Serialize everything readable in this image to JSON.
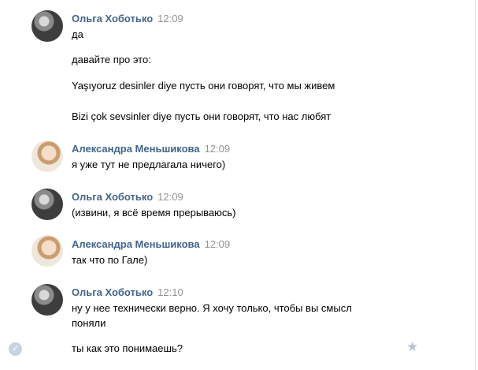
{
  "messages": [
    {
      "author": "Ольга Хоботько",
      "time": "12:09",
      "avatar": "dark",
      "lines": [
        "да",
        "давайте про это:",
        "Yaşıyoruz desinler diye пусть они говорят, что мы живем",
        "Bizi çok sevsinler diye пусть они говорят, что нас любят"
      ]
    },
    {
      "author": "Александра Меньшикова",
      "time": "12:09",
      "avatar": "light",
      "lines": [
        "я уже тут не предлагала ничего)"
      ]
    },
    {
      "author": "Ольга Хоботько",
      "time": "12:09",
      "avatar": "dark",
      "lines": [
        "(извини, я всё время прерываюсь)"
      ]
    },
    {
      "author": "Александра Меньшикова",
      "time": "12:09",
      "avatar": "light",
      "lines": [
        "так что по Гале)"
      ]
    },
    {
      "author": "Ольга Хоботько",
      "time": "12:10",
      "avatar": "dark",
      "lines": [
        "ну у нее технически верно. Я хочу только, чтобы вы смысл",
        "поняли",
        "ты как это понимаешь?"
      ]
    }
  ],
  "icons": {
    "selected_check": "checkmark-icon",
    "favorite": "star-icon"
  }
}
